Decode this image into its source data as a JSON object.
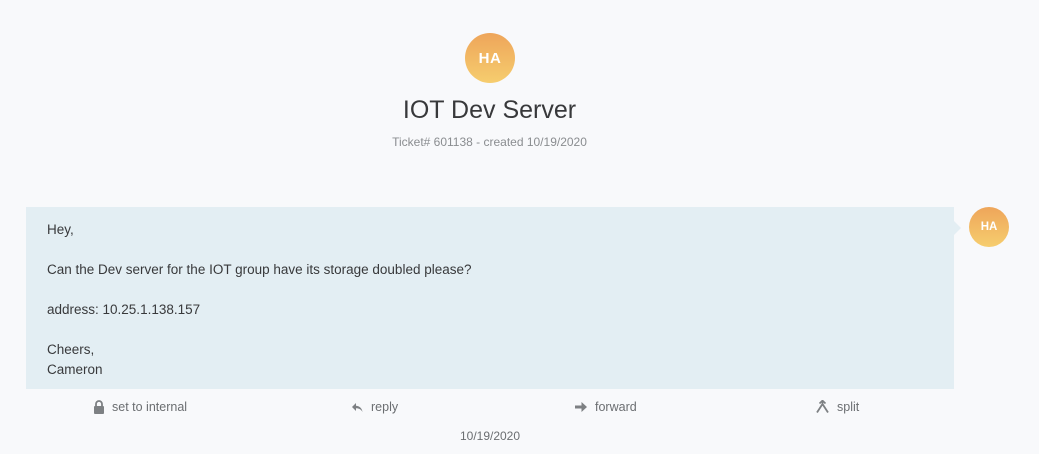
{
  "header": {
    "avatar_initials": "HA",
    "title": "IOT Dev Server",
    "subtitle": "Ticket# 601138 - created 10/19/2020"
  },
  "article": {
    "lines": {
      "greeting": "Hey,",
      "body": "Can the Dev server for the IOT group have its storage doubled please?",
      "address": "address: 10.25.1.138.157",
      "signoff": "Cheers,",
      "signature": "Cameron"
    },
    "author_initials": "HA",
    "timestamp": "10/19/2020"
  },
  "actions": {
    "set_internal": {
      "label": "set to internal",
      "icon": "lock-icon"
    },
    "reply": {
      "label": "reply",
      "icon": "reply-icon"
    },
    "forward": {
      "label": "forward",
      "icon": "forward-icon"
    },
    "split": {
      "label": "split",
      "icon": "split-icon"
    }
  },
  "colors": {
    "avatar_gradient_top": "#eea55a",
    "avatar_gradient_bottom": "#f6cd6e",
    "bubble_background": "#e3eef3",
    "page_background": "#f8f9fb"
  }
}
